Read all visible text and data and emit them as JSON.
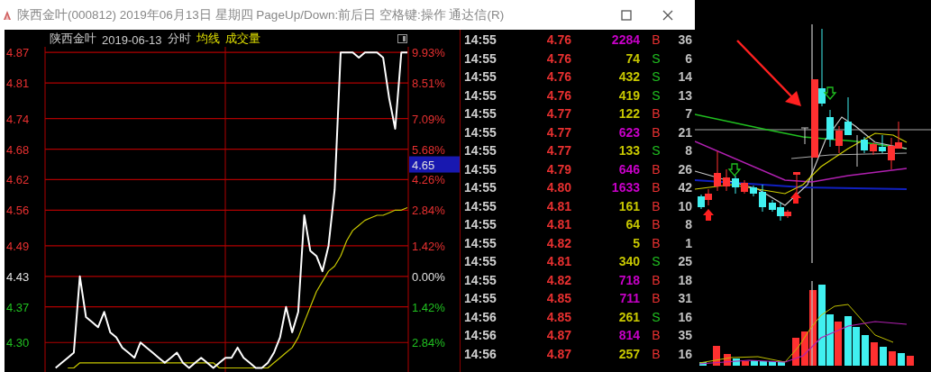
{
  "title_bar": {
    "title": "陕西金叶(000812) 2019年06月13日 星期四 PageUp/Down:前后日 空格键:操作 通达信(R)"
  },
  "minute_chart": {
    "header": {
      "name": "陕西金叶",
      "date": "2019-06-13",
      "mode": "分时",
      "indicators": [
        "均线",
        "成交量"
      ]
    },
    "current_price": "4.65",
    "right_axis": [
      {
        "label": "9.93%",
        "kind": "up"
      },
      {
        "label": "8.51%",
        "kind": "up"
      },
      {
        "label": "7.09%",
        "kind": "up"
      },
      {
        "label": "5.68%",
        "kind": "up"
      },
      {
        "label": "4.26%",
        "kind": "up"
      },
      {
        "label": "2.84%",
        "kind": "up"
      },
      {
        "label": "1.42%",
        "kind": "up"
      },
      {
        "label": "0.00%",
        "kind": "flat"
      },
      {
        "label": "1.42%",
        "kind": "down"
      },
      {
        "label": "2.84%",
        "kind": "down"
      }
    ],
    "chart_data": {
      "type": "line",
      "ylim": [
        4.242,
        4.881
      ],
      "grid": true,
      "yticks": [
        {
          "value": 4.87,
          "label": "4.87"
        },
        {
          "value": 4.81,
          "label": "4.81"
        },
        {
          "value": 4.74,
          "label": "4.74"
        },
        {
          "value": 4.68,
          "label": "4.68"
        },
        {
          "value": 4.62,
          "label": "4.62"
        },
        {
          "value": 4.56,
          "label": "4.56"
        },
        {
          "value": 4.49,
          "label": "4.49"
        },
        {
          "value": 4.43,
          "label": "4.43"
        },
        {
          "value": 4.37,
          "label": "4.37"
        },
        {
          "value": 4.3,
          "label": "4.30"
        }
      ],
      "series": [
        {
          "color": "#ffffff",
          "values": [
            null,
            4.25,
            4.26,
            4.27,
            4.28,
            4.43,
            4.35,
            4.34,
            4.33,
            4.36,
            4.32,
            4.31,
            4.29,
            4.28,
            4.27,
            4.3,
            4.29,
            4.28,
            4.27,
            4.26,
            4.27,
            4.28,
            4.26,
            4.25,
            4.26,
            4.27,
            4.26,
            4.25,
            4.26,
            4.27,
            4.27,
            4.29,
            4.27,
            4.26,
            4.25,
            4.25,
            4.26,
            4.28,
            4.31,
            4.37,
            4.32,
            4.36,
            4.55,
            4.48,
            4.47,
            4.44,
            4.49,
            4.6,
            4.87,
            4.87,
            4.87,
            4.86,
            4.87,
            4.87,
            4.87,
            4.86,
            4.78,
            4.72,
            4.87,
            4.87
          ]
        },
        {
          "color": "#c8c800",
          "values": [
            null,
            null,
            null,
            4.25,
            4.25,
            4.26,
            4.26,
            4.26,
            4.26,
            4.26,
            4.26,
            4.26,
            4.26,
            4.26,
            4.26,
            4.26,
            4.26,
            4.26,
            4.26,
            4.26,
            4.26,
            4.26,
            4.26,
            4.26,
            4.26,
            4.26,
            4.26,
            4.26,
            4.25,
            4.25,
            4.25,
            4.25,
            4.25,
            4.25,
            4.25,
            4.25,
            4.25,
            4.26,
            4.27,
            4.28,
            4.29,
            4.31,
            4.34,
            4.37,
            4.4,
            4.42,
            4.44,
            4.45,
            4.47,
            4.5,
            4.52,
            4.53,
            4.54,
            4.545,
            4.55,
            4.55,
            4.555,
            4.56,
            4.56,
            4.565
          ]
        }
      ]
    }
  },
  "ticks": [
    {
      "time": "14:55",
      "price": "4.76",
      "volume": "2284",
      "color": "#c800c8",
      "side": "B",
      "kind": "buy",
      "count": "36"
    },
    {
      "time": "14:55",
      "price": "4.76",
      "volume": "74",
      "color": "#c8c800",
      "side": "S",
      "kind": "sell",
      "count": "6"
    },
    {
      "time": "14:55",
      "price": "4.76",
      "volume": "432",
      "color": "#c8c800",
      "side": "S",
      "kind": "sell",
      "count": "14"
    },
    {
      "time": "14:55",
      "price": "4.76",
      "volume": "419",
      "color": "#c8c800",
      "side": "S",
      "kind": "sell",
      "count": "13"
    },
    {
      "time": "14:55",
      "price": "4.77",
      "volume": "122",
      "color": "#c8c800",
      "side": "B",
      "kind": "buy",
      "count": "7"
    },
    {
      "time": "14:55",
      "price": "4.77",
      "volume": "623",
      "color": "#c800c8",
      "side": "B",
      "kind": "buy",
      "count": "21"
    },
    {
      "time": "14:55",
      "price": "4.77",
      "volume": "133",
      "color": "#c8c800",
      "side": "S",
      "kind": "sell",
      "count": "8"
    },
    {
      "time": "14:55",
      "price": "4.79",
      "volume": "646",
      "color": "#c800c8",
      "side": "B",
      "kind": "buy",
      "count": "26"
    },
    {
      "time": "14:55",
      "price": "4.80",
      "volume": "1633",
      "color": "#c800c8",
      "side": "B",
      "kind": "buy",
      "count": "42"
    },
    {
      "time": "14:55",
      "price": "4.81",
      "volume": "161",
      "color": "#c8c800",
      "side": "B",
      "kind": "buy",
      "count": "10"
    },
    {
      "time": "14:55",
      "price": "4.81",
      "volume": "64",
      "color": "#c8c800",
      "side": "B",
      "kind": "buy",
      "count": "8"
    },
    {
      "time": "14:55",
      "price": "4.82",
      "volume": "5",
      "color": "#c8c800",
      "side": "B",
      "kind": "buy",
      "count": "1"
    },
    {
      "time": "14:55",
      "price": "4.81",
      "volume": "340",
      "color": "#c8c800",
      "side": "S",
      "kind": "sell",
      "count": "25"
    },
    {
      "time": "14:55",
      "price": "4.82",
      "volume": "718",
      "color": "#c800c8",
      "side": "B",
      "kind": "buy",
      "count": "18"
    },
    {
      "time": "14:55",
      "price": "4.85",
      "volume": "711",
      "color": "#c800c8",
      "side": "B",
      "kind": "buy",
      "count": "31"
    },
    {
      "time": "14:56",
      "price": "4.85",
      "volume": "261",
      "color": "#c8c800",
      "side": "S",
      "kind": "sell",
      "count": "16"
    },
    {
      "time": "14:56",
      "price": "4.87",
      "volume": "814",
      "color": "#c800c8",
      "side": "B",
      "kind": "buy",
      "count": "35"
    },
    {
      "time": "14:56",
      "price": "4.87",
      "volume": "257",
      "color": "#c8c800",
      "side": "B",
      "kind": "buy",
      "count": "16"
    }
  ]
}
